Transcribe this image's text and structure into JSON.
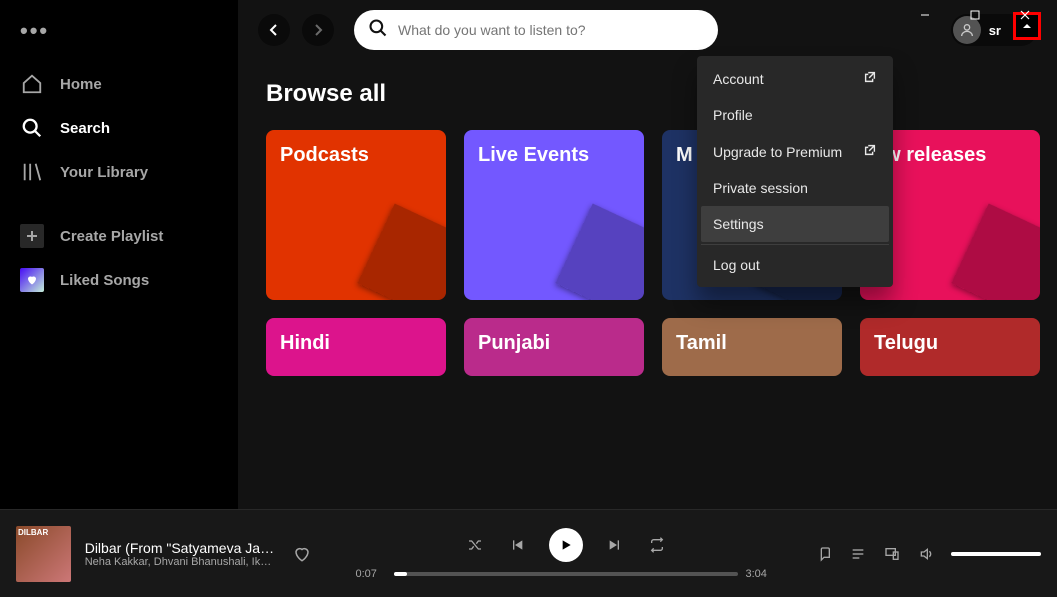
{
  "window": {
    "minimize": "–",
    "maximize": "□",
    "close": "✕"
  },
  "sidebar": {
    "home": "Home",
    "search": "Search",
    "library": "Your Library",
    "create": "Create Playlist",
    "liked": "Liked Songs"
  },
  "search": {
    "placeholder": "What do you want to listen to?"
  },
  "user": {
    "name": "sr"
  },
  "browse": {
    "title": "Browse all",
    "tiles": [
      {
        "label": "Podcasts",
        "color": "#e13300"
      },
      {
        "label": "Live Events",
        "color": "#7358ff"
      },
      {
        "label": "M",
        "color": "#1e3264"
      },
      {
        "label": "ew releases",
        "color": "#e8115b"
      }
    ],
    "tiles2": [
      {
        "label": "Hindi",
        "color": "#dc148c"
      },
      {
        "label": "Punjabi",
        "color": "#ba2b8b"
      },
      {
        "label": "Tamil",
        "color": "#9e6b4a"
      },
      {
        "label": "Telugu",
        "color": "#b02a2a"
      }
    ]
  },
  "menu": {
    "account": "Account",
    "profile": "Profile",
    "upgrade": "Upgrade to Premium",
    "private": "Private session",
    "settings": "Settings",
    "logout": "Log out"
  },
  "player": {
    "art_label": "DILBAR",
    "track": "Dilbar (From \"Satyameva Jayate",
    "artist": "Neha Kakkar, Dhvani Bhanushali, Ikka, T",
    "elapsed": "0:07",
    "total": "3:04"
  }
}
